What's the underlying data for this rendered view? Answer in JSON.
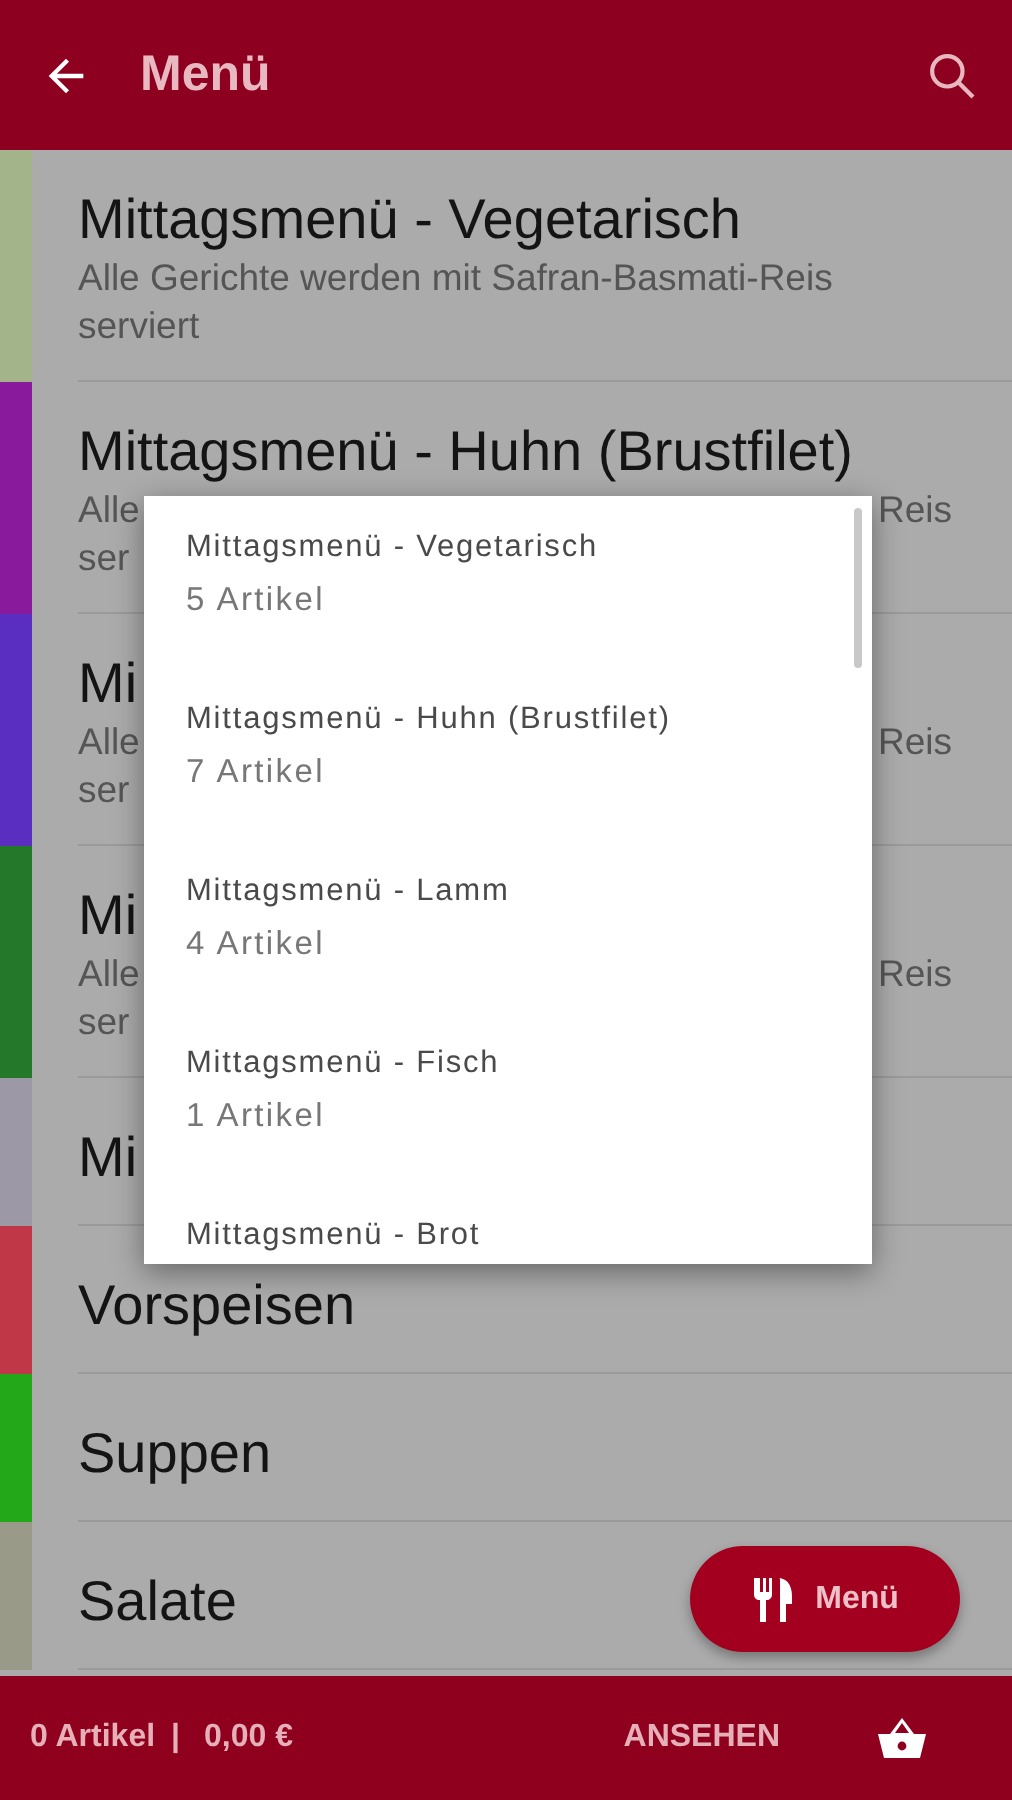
{
  "header": {
    "title": "Menü"
  },
  "categories": [
    {
      "title": "Mittagsmenü - Vegetarisch",
      "color": "#a3b48a",
      "description": [
        {
          "left": "Alle Gerichte werden mit Safran-Basmati-Reis serviert"
        }
      ]
    },
    {
      "title": "Mittagsmenü - Huhn (Brustfilet)",
      "color": "#8a1a9c",
      "description": [
        {
          "left": "Alle",
          "right": "Reis"
        },
        {
          "left": "ser"
        }
      ]
    },
    {
      "title": "Mi",
      "color": "#5a2ec0",
      "description": [
        {
          "left": "Alle",
          "right": "Reis"
        },
        {
          "left": "ser"
        }
      ]
    },
    {
      "title": "Mi",
      "color": "#24782a",
      "description": [
        {
          "left": "Alle",
          "right": "Reis"
        },
        {
          "left": "ser"
        }
      ]
    },
    {
      "title": "Mi",
      "color": "#9c98a6"
    },
    {
      "title": "Vorspeisen",
      "color": "#c03848"
    },
    {
      "title": "Suppen",
      "color": "#22a818"
    },
    {
      "title": "Salate",
      "color": "#9a9a88"
    }
  ],
  "popup": {
    "items": [
      {
        "name": "Mittagsmenü - Vegetarisch",
        "count": "5 Artikel"
      },
      {
        "name": "Mittagsmenü - Huhn (Brustfilet)",
        "count": "7 Artikel"
      },
      {
        "name": "Mittagsmenü - Lamm",
        "count": "4 Artikel"
      },
      {
        "name": "Mittagsmenü - Fisch",
        "count": "1 Artikel"
      },
      {
        "name": "Mittagsmenü - Brot"
      }
    ]
  },
  "fab": {
    "label": "Menü"
  },
  "bottom_bar": {
    "items": "0 Artikel",
    "separator": "|",
    "total": "0,00 €",
    "action": "ANSEHEN"
  }
}
